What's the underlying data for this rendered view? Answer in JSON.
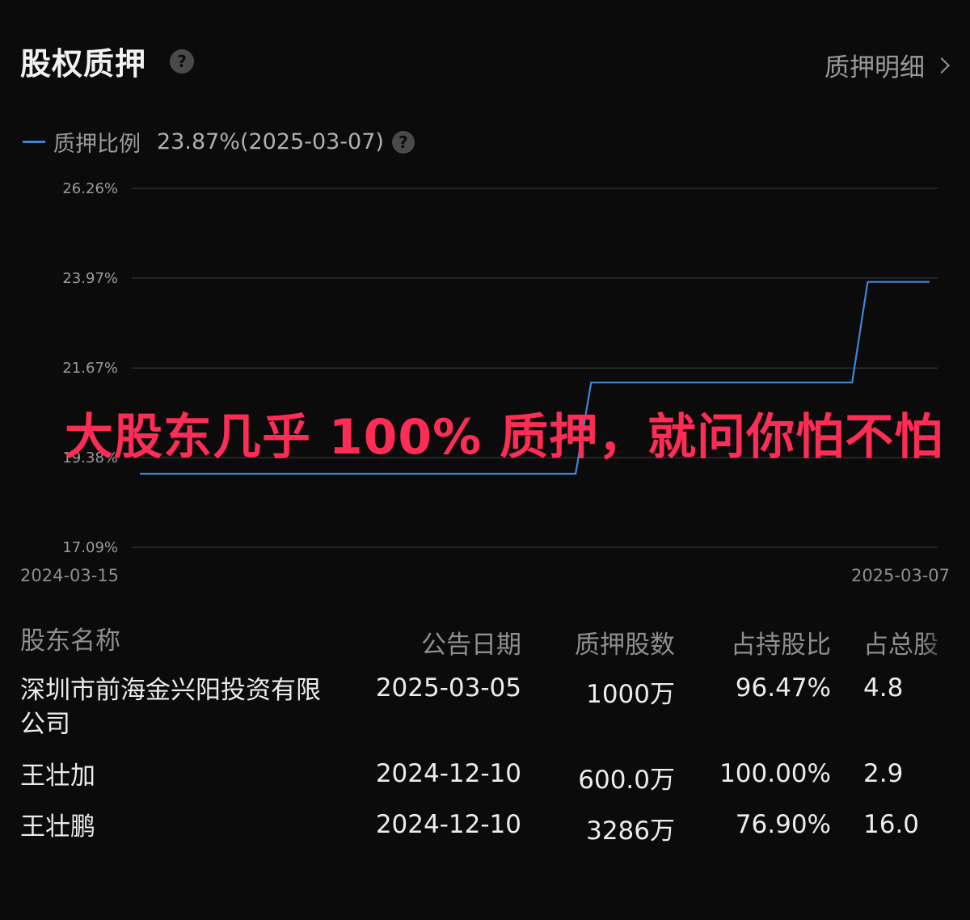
{
  "header": {
    "title": "股权质押",
    "help_icon": "question-circle-icon",
    "detail_link": "质押明细"
  },
  "legend": {
    "series_name": "质押比例",
    "current_value": "23.87%(2025-03-07)"
  },
  "chart_data": {
    "type": "line",
    "series": [
      {
        "name": "质押比例",
        "color": "#3d87d8",
        "points": [
          {
            "x": "2024-03-15",
            "y": 18.97
          },
          {
            "x": "2024-09-28",
            "y": 18.97
          },
          {
            "x": "2024-10-05",
            "y": 21.3
          },
          {
            "x": "2025-01-31",
            "y": 21.3
          },
          {
            "x": "2025-02-07",
            "y": 23.87
          },
          {
            "x": "2025-03-07",
            "y": 23.87
          }
        ]
      }
    ],
    "y_ticks": [
      "26.26%",
      "23.97%",
      "21.67%",
      "19.38%",
      "17.09%"
    ],
    "y_tick_values": [
      26.26,
      23.97,
      21.67,
      19.38,
      17.09
    ],
    "ylim": [
      17.09,
      26.26
    ],
    "x_tick_labels": [
      "2024-03-15",
      "2025-03-07"
    ],
    "xlim": [
      "2024-03-15",
      "2025-03-07"
    ],
    "grid": true
  },
  "overlay_text": "大股东几乎 100% 质押，就问你怕不怕",
  "table": {
    "columns": [
      "股东名称",
      "公告日期",
      "质押股数",
      "占持股比",
      "占总股"
    ],
    "rows": [
      {
        "name": "深圳市前海金兴阳投资有限公司",
        "date": "2025-03-05",
        "shares": "1000万",
        "pct_held": "96.47%",
        "pct_total": "4.8"
      },
      {
        "name": "王壮加",
        "date": "2024-12-10",
        "shares": "600.0万",
        "pct_held": "100.00%",
        "pct_total": "2.9"
      },
      {
        "name": "王壮鹏",
        "date": "2024-12-10",
        "shares": "3286万",
        "pct_held": "76.90%",
        "pct_total": "16.0"
      }
    ]
  }
}
